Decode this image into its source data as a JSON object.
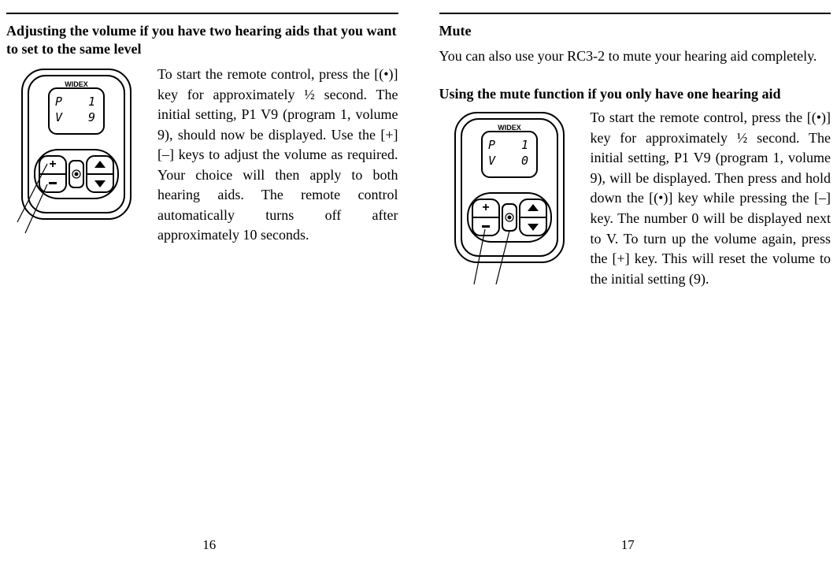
{
  "left_page": {
    "heading": "Adjusting the volume if you have two hearing aids that you want to set to the same level",
    "body": "To start the remote control, press the [(•)] key for approximately ½ second. The initial setting, P1 V9 (program 1, volume 9), should now be displayed. Use the [+] [–] keys to adjust the volume as required. Your choice will then apply to both hearing aids. The remote control automatically turns off after approximately 10 seconds.",
    "device": {
      "brand": "WIDEX",
      "line1_label": "P",
      "line1_value": "1",
      "line2_label": "V",
      "line2_value": "9"
    },
    "page_number": "16"
  },
  "right_page": {
    "heading": "Mute",
    "intro": "You can also use your RC3-2 to mute your hearing aid completely.",
    "subheading": "Using the mute function if you only have one hearing aid",
    "body": "To start the remote control, press the [(•)] key for approximately ½ second. The initial setting, P1 V9 (program 1, volume 9), will be displayed. Then press and hold down the [(•)] key while pressing the [–] key. The number 0 will be displayed next to V. To turn up the volume again, press the [+] key.  This will reset the volume to the initial setting (9).",
    "device": {
      "brand": "WIDEX",
      "line1_label": "P",
      "line1_value": "1",
      "line2_label": "V",
      "line2_value": "0"
    },
    "page_number": "17"
  }
}
